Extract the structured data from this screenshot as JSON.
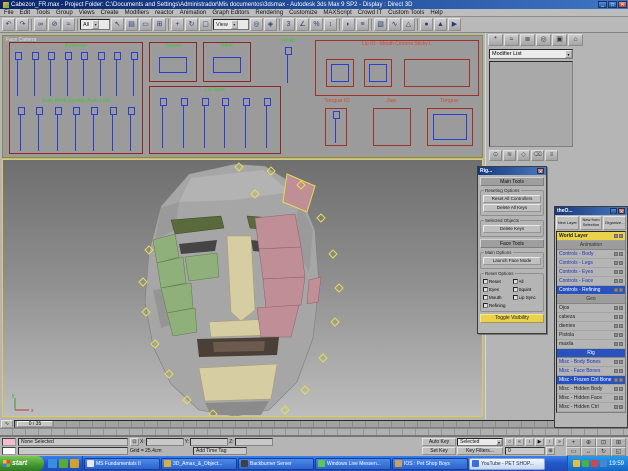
{
  "window": {
    "title": "Cabezon_FR.max - Project Folder: C:\\Documents and Settings\\Administrador\\Mis documentos\\3dsmax - Autodesk 3ds Max 9 SP2 - Display : Direct 3D"
  },
  "icons": {
    "minimize": "_",
    "maximize": "□",
    "close": "✕",
    "undo": "↶",
    "redo": "↷",
    "select_link": "∞",
    "unlink": "⊘",
    "bind_spacewarp": "≈",
    "select_object": "↖",
    "select_by_name": "▤",
    "region_rect": "▭",
    "crossing": "⊞",
    "move": "+",
    "rotate": "↻",
    "scale": "▢",
    "use_pivot": "◎",
    "manipulate": "◈",
    "snap_3d": "3",
    "angle_snap": "∠",
    "percent_snap": "%",
    "spinner_snap": "↕",
    "mirror": "◐",
    "align": "≡",
    "layer_manager": "▧",
    "curve_editor": "∿",
    "schematic_view": "△",
    "material_editor": "●",
    "render_scene": "▲",
    "quick_render": "▶",
    "combo_arrow": "▾",
    "tab_create": "*",
    "tab_modify": "≈",
    "tab_hierarchy": "≣",
    "tab_motion": "◎",
    "tab_display": "▣",
    "tab_utilities": "⌂",
    "dialog_close": "✕",
    "dialog_min": "_",
    "lock": "⊡",
    "key_toggle": "○",
    "goto_start": "«",
    "prev_frame": "‹",
    "play": "▶",
    "next_frame": "›",
    "goto_end": "»",
    "time_config": "⊞",
    "zoom": "+",
    "zoom_all": "⊕",
    "zoom_extents": "⊡",
    "zoom_extents_all": "⊞",
    "zoom_region": "▭",
    "pan": "↔",
    "orbit": "↻",
    "minmax_toggle": "◱",
    "mini_curve_editor": "∿"
  },
  "menu": {
    "items": [
      "File",
      "Edit",
      "Tools",
      "Group",
      "Views",
      "Create",
      "Modifiers",
      "reactor",
      "Animation",
      "Graph Editors",
      "Rendering",
      "Customize",
      "MAXScript",
      "Crowd IT",
      "Custom Tools",
      "Help"
    ]
  },
  "toolbar": {
    "selection_filter_value": "All",
    "ref_coord_value": "View"
  },
  "viewports": {
    "top_label": "Face Camera",
    "face_ui": {
      "eyebrow": "Eyebrow",
      "squint": "Squint",
      "blink": "Blink",
      "head": "Head",
      "lip_io": "Lip IO - Mouth Corners Sticky L",
      "auto_blink": "Auto Blink Eyelids Auto Lids",
      "lip_sync": "Lip Sync",
      "tongue_io": "Tongue IO",
      "jaw": "Jaw",
      "tongue": "Tongue"
    }
  },
  "command_panel": {
    "modifier_list": "Modifier List"
  },
  "rig_dialog": {
    "title": "Rig...",
    "main_tools": "Main Tools",
    "reseting_options": "Reseting Options",
    "reset_all_controllers": "Reset All Controllers",
    "delete_all_keys": "Delete All Keys",
    "selected_objects": "Selected Objects",
    "delete_keys": "Delete Keys",
    "face_tools": "Face Tools",
    "main_options": "Main Options",
    "launch_face_mode": "Launch Face Mode",
    "reset_options": "Reset Options",
    "check_reset": "Reset",
    "check_all": "All",
    "check_eyes": "Eyes",
    "check_squint": "Squint",
    "check_mouth": "Mouth",
    "check_lip_sync": "Lip Sync",
    "check_refining": "Refining",
    "toggle_visibility": "Toggle Visibility"
  },
  "layers_dialog": {
    "title": "theO...",
    "btn_new_layer": "New Layer",
    "btn_new_from_selection": "New from Selection",
    "btn_organize": "Organize...",
    "world_layer": "World Layer",
    "groups": [
      {
        "header": "Animation",
        "items": [
          "Controls - Body",
          "Controls - Legs",
          "Controls - Eyes",
          "Controls - Face",
          "Controls - Refining"
        ]
      },
      {
        "header": "Geo",
        "items": [
          "Ojos",
          "cabeza",
          "dientes",
          "Pistola",
          "maxila"
        ]
      },
      {
        "header": "Rig",
        "items": [
          "Misc - Body Bones",
          "Misc - Face Bones",
          "Misc - Frozen Ctrl Bone",
          "Misc - Hidden Body",
          "Misc - Hidden Face",
          "Misc - Hidden Ctrl"
        ]
      }
    ]
  },
  "timeline": {
    "frame_display": "0 / 35"
  },
  "status_bar": {
    "status": "None Selected",
    "x_label": "X:",
    "y_label": "Y:",
    "z_label": "Z:",
    "grid": "Grid = 25.4cm",
    "add_time_tag": "Add Time Tag",
    "auto_key": "Auto Key",
    "set_key": "Set Key",
    "key_mode": "Selected",
    "key_filters": "Key Filters...",
    "frame_field": "0"
  },
  "taskbar": {
    "start": "start",
    "windows": [
      "MS Fundamentals II",
      "3D_Amax_&_Object...",
      "Backburner Server",
      "Windows Live Messen...",
      "IOS : Pet Shop Boys",
      "YouTube - PET SHOP..."
    ],
    "time": "19:59"
  },
  "colors": {
    "selection_yellow": "#e8d44a",
    "selection_blue": "#2a52be",
    "ui_label_green": "#3fc43f",
    "ui_label_red": "#d64a33",
    "viewport_border_yellow": "#e0d040"
  }
}
